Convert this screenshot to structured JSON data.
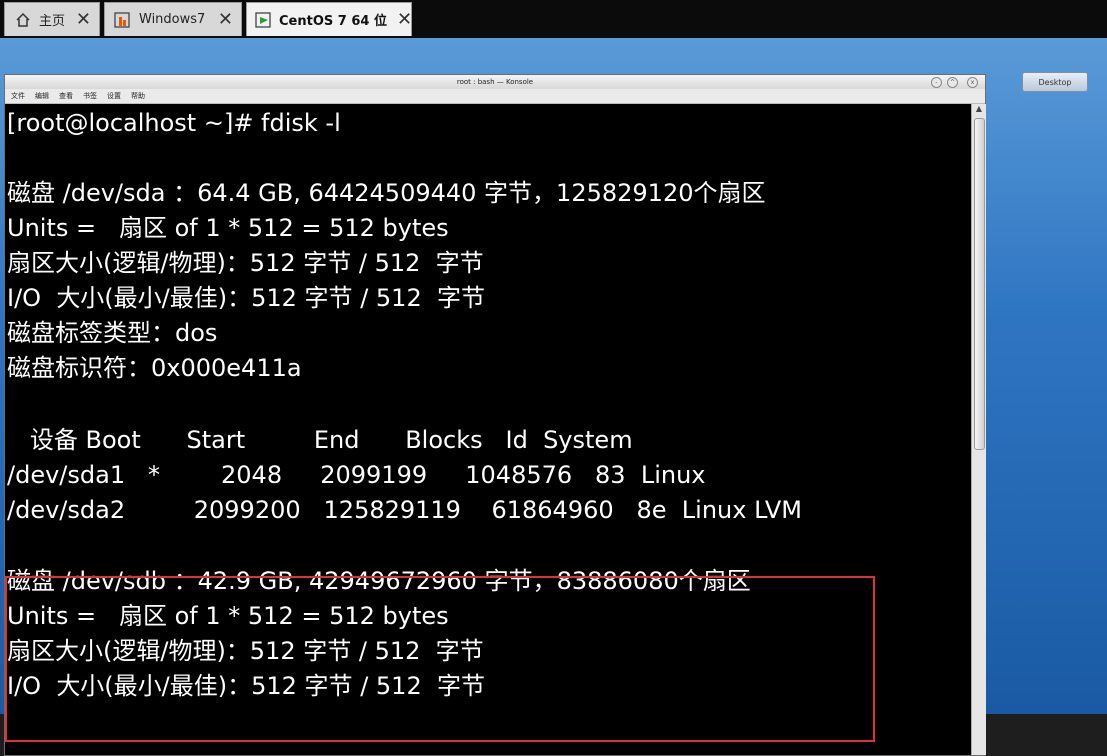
{
  "tabs": [
    {
      "label": "主页",
      "icon": "home-icon"
    },
    {
      "label": "Windows7",
      "icon": "vm-icon"
    },
    {
      "label": "CentOS 7 64 位",
      "icon": "vm-icon",
      "active": true
    }
  ],
  "konsole": {
    "title": "root : bash — Konsole",
    "menu": [
      "文件",
      "编辑",
      "查看",
      "书签",
      "设置",
      "帮助"
    ]
  },
  "desktop_label": "Desktop",
  "terminal_lines": [
    "[root@localhost ~]# fdisk -l",
    "",
    "磁盘 /dev/sda ：64.4 GB, 64424509440 字节，125829120个扇区",
    "Units =   扇区 of 1 * 512 = 512 bytes",
    "扇区大小(逻辑/物理)：512 字节 / 512  字节",
    "I/O  大小(最小/最佳)：512 字节 / 512  字节",
    "磁盘标签类型：dos",
    "磁盘标识符：0x000e411a",
    "",
    "   设备 Boot      Start         End      Blocks   Id  System",
    "/dev/sda1   *        2048     2099199     1048576   83  Linux",
    "/dev/sda2         2099200   125829119    61864960   8e  Linux LVM",
    "",
    "磁盘 /dev/sdb ：42.9 GB, 42949672960 字节，83886080个扇区",
    "Units =   扇区 of 1 * 512 = 512 bytes",
    "扇区大小(逻辑/物理)：512 字节 / 512  字节",
    "I/O  大小(最小/最佳)：512 字节 / 512  字节"
  ],
  "colors": {
    "highlight": "#e0303a",
    "terminal_bg": "#000000",
    "terminal_fg": "#ffffff"
  }
}
